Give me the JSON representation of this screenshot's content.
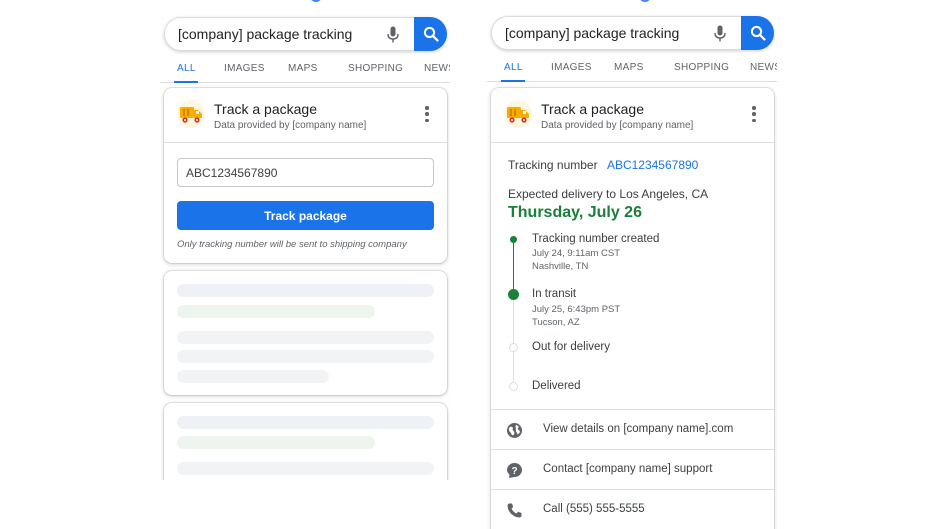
{
  "colors": {
    "accent": "#1a73e8",
    "delivered_green": "#188038",
    "skeleton_blue": "#eef2f7",
    "skeleton_green": "#eef5ee"
  },
  "left": {
    "search": {
      "query": "[company] package tracking"
    },
    "tabs": [
      "ALL",
      "IMAGES",
      "MAPS",
      "SHOPPING",
      "NEWS"
    ],
    "card": {
      "title": "Track a package",
      "subtitle": "Data provided by [company name]",
      "input_value": "ABC1234567890",
      "button_label": "Track package",
      "note": "Only tracking number will be sent to shipping company"
    }
  },
  "right": {
    "search": {
      "query": "[company] package tracking"
    },
    "tabs": [
      "ALL",
      "IMAGES",
      "MAPS",
      "SHOPPING",
      "NEWS"
    ],
    "card": {
      "title": "Track a package",
      "subtitle": "Data provided by [company name]",
      "tracking_label": "Tracking number",
      "tracking_number": "ABC1234567890",
      "expected_label": "Expected delivery to Los Angeles, CA",
      "expected_date": "Thursday, July 26",
      "timeline": [
        {
          "title": "Tracking number created",
          "time": "July 24, 9:11am CST",
          "place": "Nashville, TN",
          "state": "done"
        },
        {
          "title": "In transit",
          "time": "July 25, 6:43pm PST",
          "place": "Tucson, AZ",
          "state": "current"
        },
        {
          "title": "Out for delivery",
          "state": "pending"
        },
        {
          "title": "Delivered",
          "state": "pending"
        }
      ],
      "actions": [
        {
          "icon": "globe-icon",
          "label": "View details on [company name].com"
        },
        {
          "icon": "help-icon",
          "label": "Contact [company name] support"
        },
        {
          "icon": "phone-icon",
          "label": "Call (555) 555-5555"
        }
      ]
    }
  }
}
